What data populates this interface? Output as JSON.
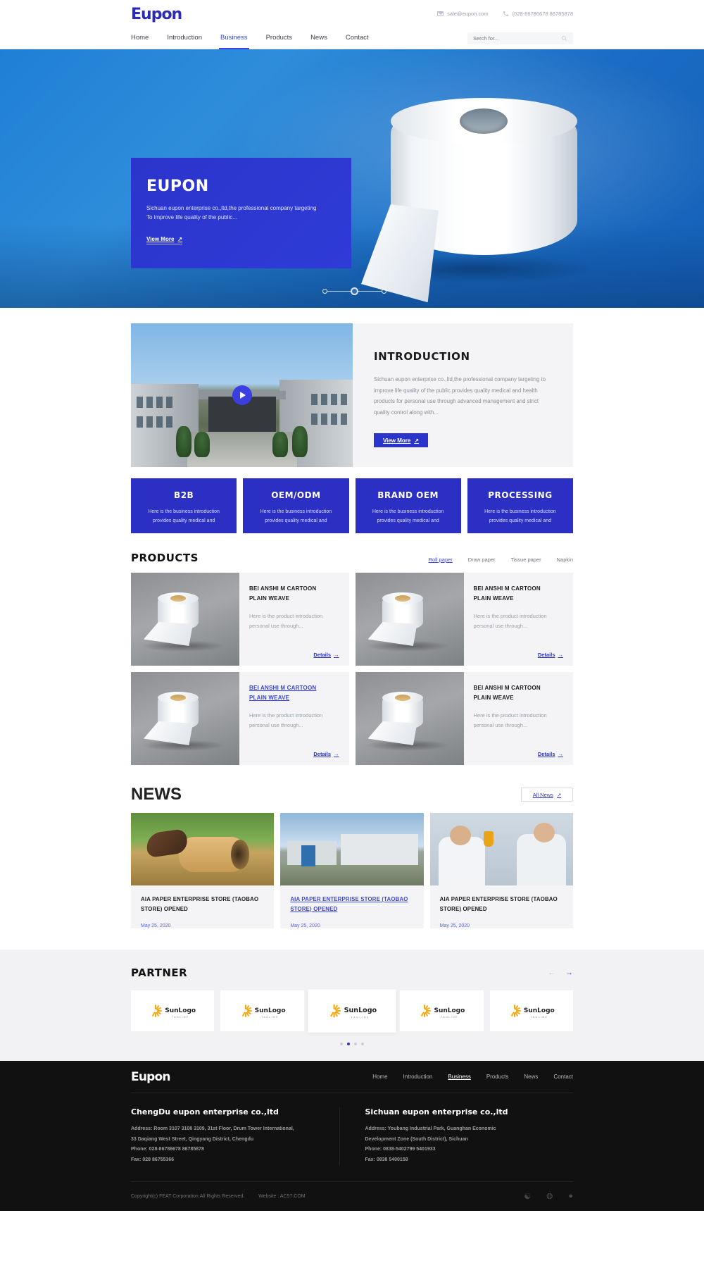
{
  "brand": {
    "logo_text": "Eupon",
    "footer_logo_text": "Eupon"
  },
  "topbar": {
    "email": "sale@eupon.com",
    "phone": "(028-86786678 86785878",
    "email_icon": "mail-icon",
    "phone_icon": "phone-icon"
  },
  "nav": {
    "items": [
      {
        "label": "Home"
      },
      {
        "label": "Introduction"
      },
      {
        "label": "Business"
      },
      {
        "label": "Products"
      },
      {
        "label": "News"
      },
      {
        "label": "Contact"
      }
    ],
    "active": "Business"
  },
  "search": {
    "placeholder": "Serch for...",
    "value": "",
    "icon": "search-icon"
  },
  "hero": {
    "title": "EUPON",
    "line1": "Sichuan eupon enterprise co.,ltd,the professional company targeting",
    "line2": "To improve life quality of the public...",
    "cta": "View More",
    "cta_icon": "arrow-up-right-icon"
  },
  "introduction": {
    "heading": "INTRODUCTION",
    "body": "Sichuan eupon enterprise co.,ltd,the professional company targeting to improve life quality of the public.provides quality medical and health products for personal use through advanced management and strict quality control along with...",
    "cta": "View More",
    "play_icon": "play-icon"
  },
  "business": {
    "cards": [
      {
        "title": "B2B",
        "line1": "Here is the business introduction",
        "line2": "provides quality medical and"
      },
      {
        "title": "OEM/ODM",
        "line1": "Here is the business introduction",
        "line2": "provides quality medical and"
      },
      {
        "title": "BRAND OEM",
        "line1": "Here is the business introduction",
        "line2": "provides quality medical and"
      },
      {
        "title": "PROCESSING",
        "line1": "Here is the business introduction",
        "line2": "provides quality medical and"
      }
    ]
  },
  "products": {
    "heading": "PRODUCTS",
    "filters": [
      {
        "label": "Roll paper",
        "active": true
      },
      {
        "label": "Draw paper",
        "active": false
      },
      {
        "label": "Tissue paper",
        "active": false
      },
      {
        "label": "Napkin",
        "active": false
      }
    ],
    "items": [
      {
        "title_l1": "BEI ANSHI M CARTOON",
        "title_l2": "PLAIN WEAVE",
        "desc_l1": "Here is the product introduction",
        "desc_l2": "personal use through...",
        "details": "Details",
        "highlighted": false
      },
      {
        "title_l1": "BEI ANSHI M CARTOON",
        "title_l2": "PLAIN WEAVE",
        "desc_l1": "Here is the product introduction",
        "desc_l2": "personal use through...",
        "details": "Details",
        "highlighted": false
      },
      {
        "title_l1": "BEI ANSHI M CARTOON",
        "title_l2": "PLAIN WEAVE",
        "desc_l1": "Here is the product introduction",
        "desc_l2": "personal use through...",
        "details": "Details",
        "highlighted": true
      },
      {
        "title_l1": "BEI ANSHI M CARTOON",
        "title_l2": "PLAIN WEAVE",
        "desc_l1": "Here is the product introduction",
        "desc_l2": "personal use through...",
        "details": "Details",
        "highlighted": false
      }
    ]
  },
  "news": {
    "heading": "NEWS",
    "all_label": "All News",
    "items": [
      {
        "title_l1": "AIA PAPER ENTERPRISE STORE (TAOBAO",
        "title_l2": "STORE) OPENED",
        "date": "May 25, 2020",
        "highlighted": false
      },
      {
        "title_l1": "AIA PAPER ENTERPRISE STORE (TAOBAO",
        "title_l2": "STORE) OPENED",
        "date": "May 25, 2020",
        "highlighted": true
      },
      {
        "title_l1": "AIA PAPER ENTERPRISE STORE (TAOBAO",
        "title_l2": "STORE) OPENED",
        "date": "May 25, 2020",
        "highlighted": false
      }
    ]
  },
  "partner": {
    "heading": "PARTNER",
    "prev_icon": "arrow-left-icon",
    "next_icon": "arrow-right-icon",
    "logos": [
      {
        "name": "SunLogo",
        "tagline": "TAGLINE"
      },
      {
        "name": "SunLogo",
        "tagline": "TAGLINE"
      },
      {
        "name": "SunLogo",
        "tagline": "TAGLINE"
      },
      {
        "name": "SunLogo",
        "tagline": "TAGLINE"
      },
      {
        "name": "SunLogo",
        "tagline": "TAGLINE"
      }
    ],
    "dots": 4,
    "active_dot": 1
  },
  "footer": {
    "nav": [
      {
        "label": "Home"
      },
      {
        "label": "Introduction"
      },
      {
        "label": "Business"
      },
      {
        "label": "Products"
      },
      {
        "label": "News"
      },
      {
        "label": "Contact"
      }
    ],
    "columns": [
      {
        "title": "ChengDu eupon enterprise co.,ltd",
        "address_l1": "Address: Room 3107 3108 3109, 31st Floor, Drum Tower International,",
        "address_l2": "33 Daqiang West Street, Qingyang District, Chengdu",
        "phone": "Phone: 028-86786678 86785878",
        "fax": "Fax: 028 86755366"
      },
      {
        "title": "Sichuan eupon enterprise co.,ltd",
        "address_l1": "Address: Youbang Industrial Park, Guanghan Economic",
        "address_l2": "Development Zone (South District), Sichuan",
        "phone": "Phone: 0838-5402799 5401933",
        "fax": "Fax: 0838 5400158"
      }
    ],
    "copyright": "Copyright(c) FEAT Corporation.All Rights Reserved.",
    "website": "Website : AC57.COM",
    "social": [
      {
        "icon": "wechat-icon"
      },
      {
        "icon": "weibo-icon"
      },
      {
        "icon": "qq-icon"
      }
    ]
  },
  "colors": {
    "brand": "#2b35cc",
    "accent": "#3b46e0",
    "hero_blue": "#1f7fd4",
    "footer_bg": "#111111"
  }
}
